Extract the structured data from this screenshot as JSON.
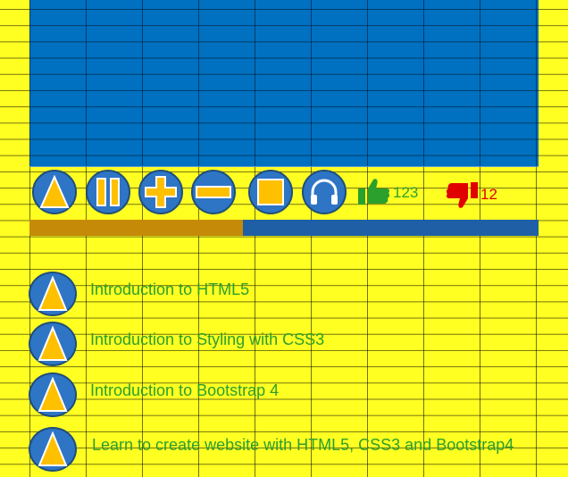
{
  "player": {
    "like_count": "123",
    "dislike_count": "12",
    "progress": 0.42,
    "colors": {
      "screen": "#0070c0",
      "button": "#2e75c6",
      "glyph": "#ffc000",
      "like": "#2ca02c",
      "dislike": "#e00000",
      "progress_played": "#c58a08",
      "progress_track": "#1f5fa5"
    },
    "controls": [
      "play-icon",
      "pause-icon",
      "plus-icon",
      "minus-icon",
      "stop-icon",
      "headphones-icon"
    ]
  },
  "playlist": [
    {
      "label": "Introduction to HTML5",
      "icon": "play-icon"
    },
    {
      "label": "Introduction to Styling with CSS3",
      "icon": "play-icon"
    },
    {
      "label": "Introduction to Bootstrap 4",
      "icon": "play-icon"
    },
    {
      "label": "Learn to create website with HTML5, CSS3 and Bootstrap4",
      "icon": "play-icon"
    }
  ]
}
